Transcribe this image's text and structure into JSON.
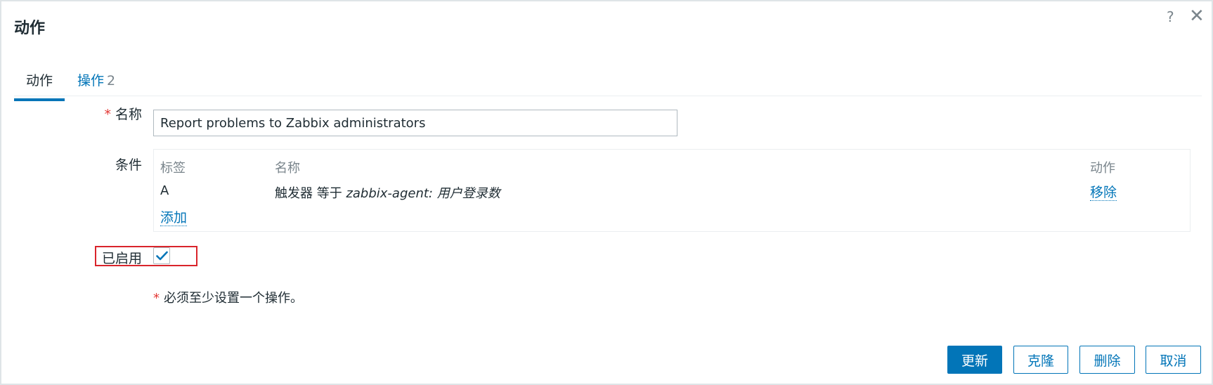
{
  "dialog": {
    "title": "动作",
    "help_icon": "?",
    "close_icon": "✕"
  },
  "tabs": [
    {
      "label": "动作",
      "active": true
    },
    {
      "label": "操作",
      "count": "2",
      "active": false
    }
  ],
  "form": {
    "name_label": "名称",
    "name_value": "Report problems to Zabbix administrators",
    "conditions_label": "条件",
    "conditions": {
      "headers": {
        "tag": "标签",
        "name": "名称",
        "action": "动作"
      },
      "rows": [
        {
          "tag": "A",
          "name_prefix": "触发器 等于 ",
          "name_value": "zabbix-agent: 用户登录数",
          "action": "移除"
        }
      ],
      "add_label": "添加"
    },
    "enabled_label": "已启用",
    "enabled": true,
    "required_note": "必须至少设置一个操作。",
    "required_mark": "*"
  },
  "buttons": {
    "update": "更新",
    "clone": "克隆",
    "delete": "删除",
    "cancel": "取消"
  },
  "colors": {
    "accent": "#0275b8",
    "required": "#e33734",
    "highlight_border": "#d9242b"
  }
}
